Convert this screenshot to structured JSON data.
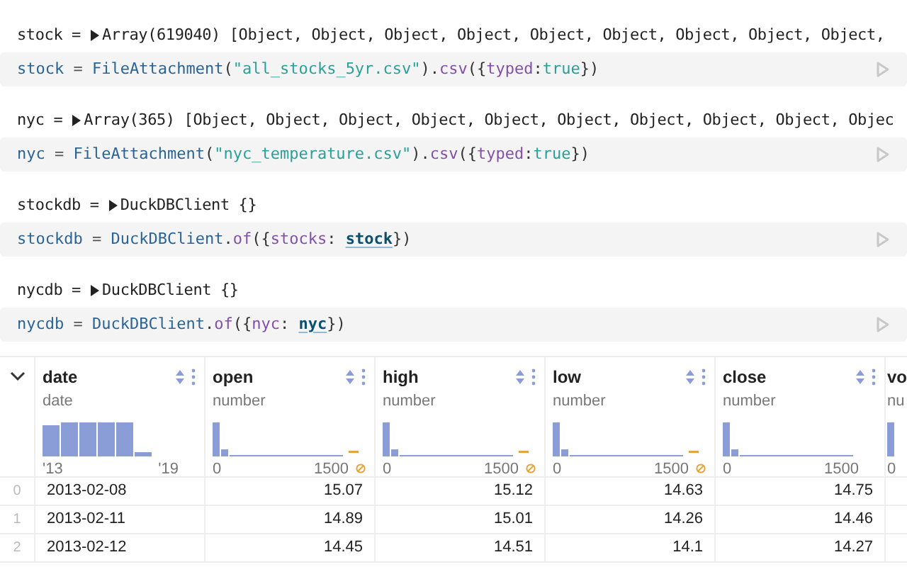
{
  "cells": [
    {
      "output": {
        "name": "stock =",
        "summary": "Array(619040) [Object, Object, Object, Object, Object, Object, Object, Object, Object,"
      },
      "code": [
        {
          "kind": "name",
          "text": "stock"
        },
        {
          "kind": "op",
          "text": " = "
        },
        {
          "kind": "fn",
          "text": "FileAttachment"
        },
        {
          "kind": "punct",
          "text": "("
        },
        {
          "kind": "str",
          "text": "\"all_stocks_5yr.csv\""
        },
        {
          "kind": "punct",
          "text": ")."
        },
        {
          "kind": "prop",
          "text": "csv"
        },
        {
          "kind": "punct",
          "text": "({"
        },
        {
          "kind": "prop",
          "text": "typed"
        },
        {
          "kind": "punct",
          "text": ":"
        },
        {
          "kind": "bool",
          "text": "true"
        },
        {
          "kind": "punct",
          "text": "})"
        }
      ]
    },
    {
      "output": {
        "name": "nyc =",
        "summary": "Array(365) [Object, Object, Object, Object, Object, Object, Object, Object, Object, Objec"
      },
      "code": [
        {
          "kind": "name",
          "text": "nyc"
        },
        {
          "kind": "op",
          "text": " = "
        },
        {
          "kind": "fn",
          "text": "FileAttachment"
        },
        {
          "kind": "punct",
          "text": "("
        },
        {
          "kind": "str",
          "text": "\"nyc_temperature.csv\""
        },
        {
          "kind": "punct",
          "text": ")."
        },
        {
          "kind": "prop",
          "text": "csv"
        },
        {
          "kind": "punct",
          "text": "({"
        },
        {
          "kind": "prop",
          "text": "typed"
        },
        {
          "kind": "punct",
          "text": ":"
        },
        {
          "kind": "bool",
          "text": "true"
        },
        {
          "kind": "punct",
          "text": "})"
        }
      ]
    },
    {
      "output": {
        "name": "stockdb =",
        "summary": "DuckDBClient {}"
      },
      "code": [
        {
          "kind": "name",
          "text": "stockdb"
        },
        {
          "kind": "op",
          "text": " = "
        },
        {
          "kind": "fn",
          "text": "DuckDBClient"
        },
        {
          "kind": "punct",
          "text": "."
        },
        {
          "kind": "prop",
          "text": "of"
        },
        {
          "kind": "punct",
          "text": "({"
        },
        {
          "kind": "prop",
          "text": "stocks"
        },
        {
          "kind": "punct",
          "text": ": "
        },
        {
          "kind": "ref",
          "text": "stock"
        },
        {
          "kind": "punct",
          "text": "})"
        }
      ]
    },
    {
      "output": {
        "name": "nycdb =",
        "summary": "DuckDBClient {}"
      },
      "code": [
        {
          "kind": "name",
          "text": "nycdb"
        },
        {
          "kind": "op",
          "text": " = "
        },
        {
          "kind": "fn",
          "text": "DuckDBClient"
        },
        {
          "kind": "punct",
          "text": "."
        },
        {
          "kind": "prop",
          "text": "of"
        },
        {
          "kind": "punct",
          "text": "({"
        },
        {
          "kind": "prop",
          "text": "nyc"
        },
        {
          "kind": "punct",
          "text": ": "
        },
        {
          "kind": "ref",
          "text": "nyc"
        },
        {
          "kind": "punct",
          "text": "})"
        }
      ]
    }
  ],
  "table": {
    "columns": [
      {
        "name": "date",
        "type": "date",
        "kind": "uniform",
        "min_label": "'13",
        "max_label": "'19",
        "has_missing": false
      },
      {
        "name": "open",
        "type": "number",
        "kind": "skewed",
        "min_label": "0",
        "max_label": "1500",
        "has_missing": true
      },
      {
        "name": "high",
        "type": "number",
        "kind": "skewed",
        "min_label": "0",
        "max_label": "1500",
        "has_missing": true
      },
      {
        "name": "low",
        "type": "number",
        "kind": "skewed",
        "min_label": "0",
        "max_label": "1500",
        "has_missing": true
      },
      {
        "name": "close",
        "type": "number",
        "kind": "skewed",
        "min_label": "0",
        "max_label": "1500",
        "has_missing": false
      },
      {
        "name": "vo",
        "type": "nu",
        "kind": "partial",
        "min_label": "0"
      }
    ],
    "rows": [
      {
        "index": "0",
        "cells": [
          "2013-02-08",
          "15.07",
          "15.12",
          "14.63",
          "14.75"
        ]
      },
      {
        "index": "1",
        "cells": [
          "2013-02-11",
          "14.89",
          "15.01",
          "14.26",
          "14.46"
        ]
      },
      {
        "index": "2",
        "cells": [
          "2013-02-12",
          "14.45",
          "14.51",
          "14.1",
          "14.27"
        ]
      }
    ]
  }
}
